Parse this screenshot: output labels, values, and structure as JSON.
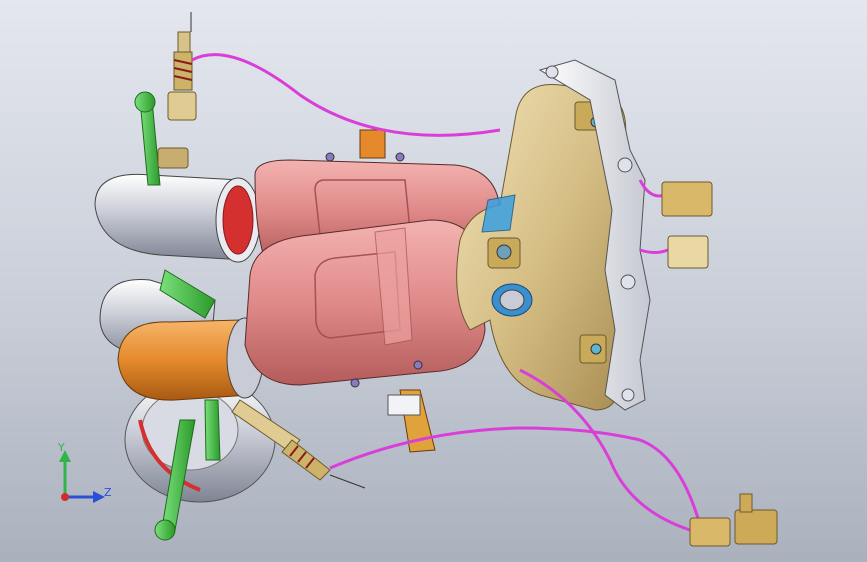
{
  "viewport": {
    "background_top": "#e4e7ee",
    "background_bottom": "#aab1bd"
  },
  "triad": {
    "y_label": "Y",
    "z_label": "Z",
    "y_color": "#2fb54a",
    "z_color": "#2b4fd6",
    "x_color": "#d42a2a"
  },
  "colors": {
    "converter_shell": "#e08a8a",
    "manifold": "#d6bf86",
    "elbow": "#e48a2c",
    "tube_metal": "#c9ccd6",
    "bracket_green": "#3dbb3d",
    "wire_magenta": "#d93fd8",
    "flange": "#eef0f4",
    "connector": "#d9b86a"
  },
  "components": [
    {
      "name": "catalytic-converter-upper"
    },
    {
      "name": "catalytic-converter-lower"
    },
    {
      "name": "exhaust-manifold"
    },
    {
      "name": "cylinder-head-flange"
    },
    {
      "name": "turbo-outlet-elbow"
    },
    {
      "name": "oxygen-sensor-upstream"
    },
    {
      "name": "oxygen-sensor-downstream"
    },
    {
      "name": "sensor-wire-harness"
    },
    {
      "name": "wire-connectors"
    },
    {
      "name": "support-brackets"
    }
  ]
}
